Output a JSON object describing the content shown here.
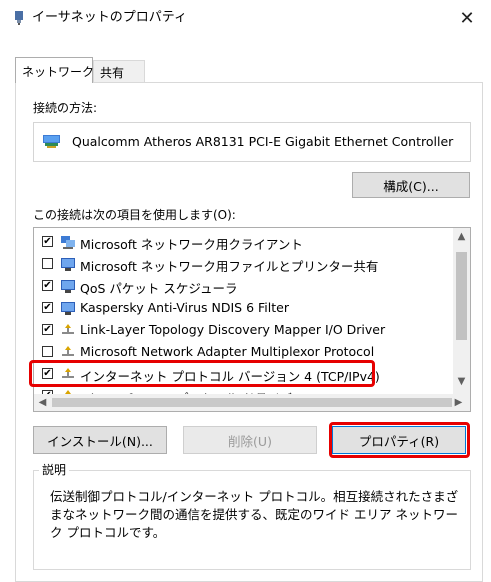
{
  "window": {
    "title": "イーサネットのプロパティ",
    "close_glyph": "✕"
  },
  "tabs": [
    {
      "label": "ネットワーク",
      "active": true
    },
    {
      "label": "共有",
      "active": false
    }
  ],
  "connection": {
    "label": "接続の方法:",
    "adapter_name": "Qualcomm Atheros AR8131 PCI-E Gigabit Ethernet Controller",
    "configure_button": "構成(C)..."
  },
  "items_section": {
    "label": "この接続は次の項目を使用します(O):",
    "items": [
      {
        "checked": true,
        "icon": "network-client-icon",
        "label": "Microsoft ネットワーク用クライアント"
      },
      {
        "checked": false,
        "icon": "network-service-icon",
        "label": "Microsoft ネットワーク用ファイルとプリンター共有"
      },
      {
        "checked": true,
        "icon": "network-service-icon",
        "label": "QoS パケット スケジューラ"
      },
      {
        "checked": true,
        "icon": "network-service-icon",
        "label": "Kaspersky Anti-Virus NDIS 6 Filter"
      },
      {
        "checked": true,
        "icon": "protocol-icon",
        "label": "Link-Layer Topology Discovery Mapper I/O Driver"
      },
      {
        "checked": false,
        "icon": "protocol-icon",
        "label": "Microsoft Network Adapter Multiplexor Protocol"
      },
      {
        "checked": true,
        "icon": "protocol-icon",
        "label": "インターネット プロトコル バージョン 4 (TCP/IPv4)"
      },
      {
        "checked": true,
        "icon": "protocol-icon",
        "label": "Microsoft LLDP プロトコル ドライバー"
      }
    ]
  },
  "buttons": {
    "install": "インストール(N)...",
    "uninstall": "削除(U)",
    "properties": "プロパティ(R)"
  },
  "description": {
    "title": "説明",
    "text": "伝送制御プロトコル/インターネット プロトコル。相互接続されたさまざまなネットワーク間の通信を提供する、既定のワイド エリア ネットワーク プロトコルです。"
  },
  "colors": {
    "highlight": "#e60000"
  }
}
